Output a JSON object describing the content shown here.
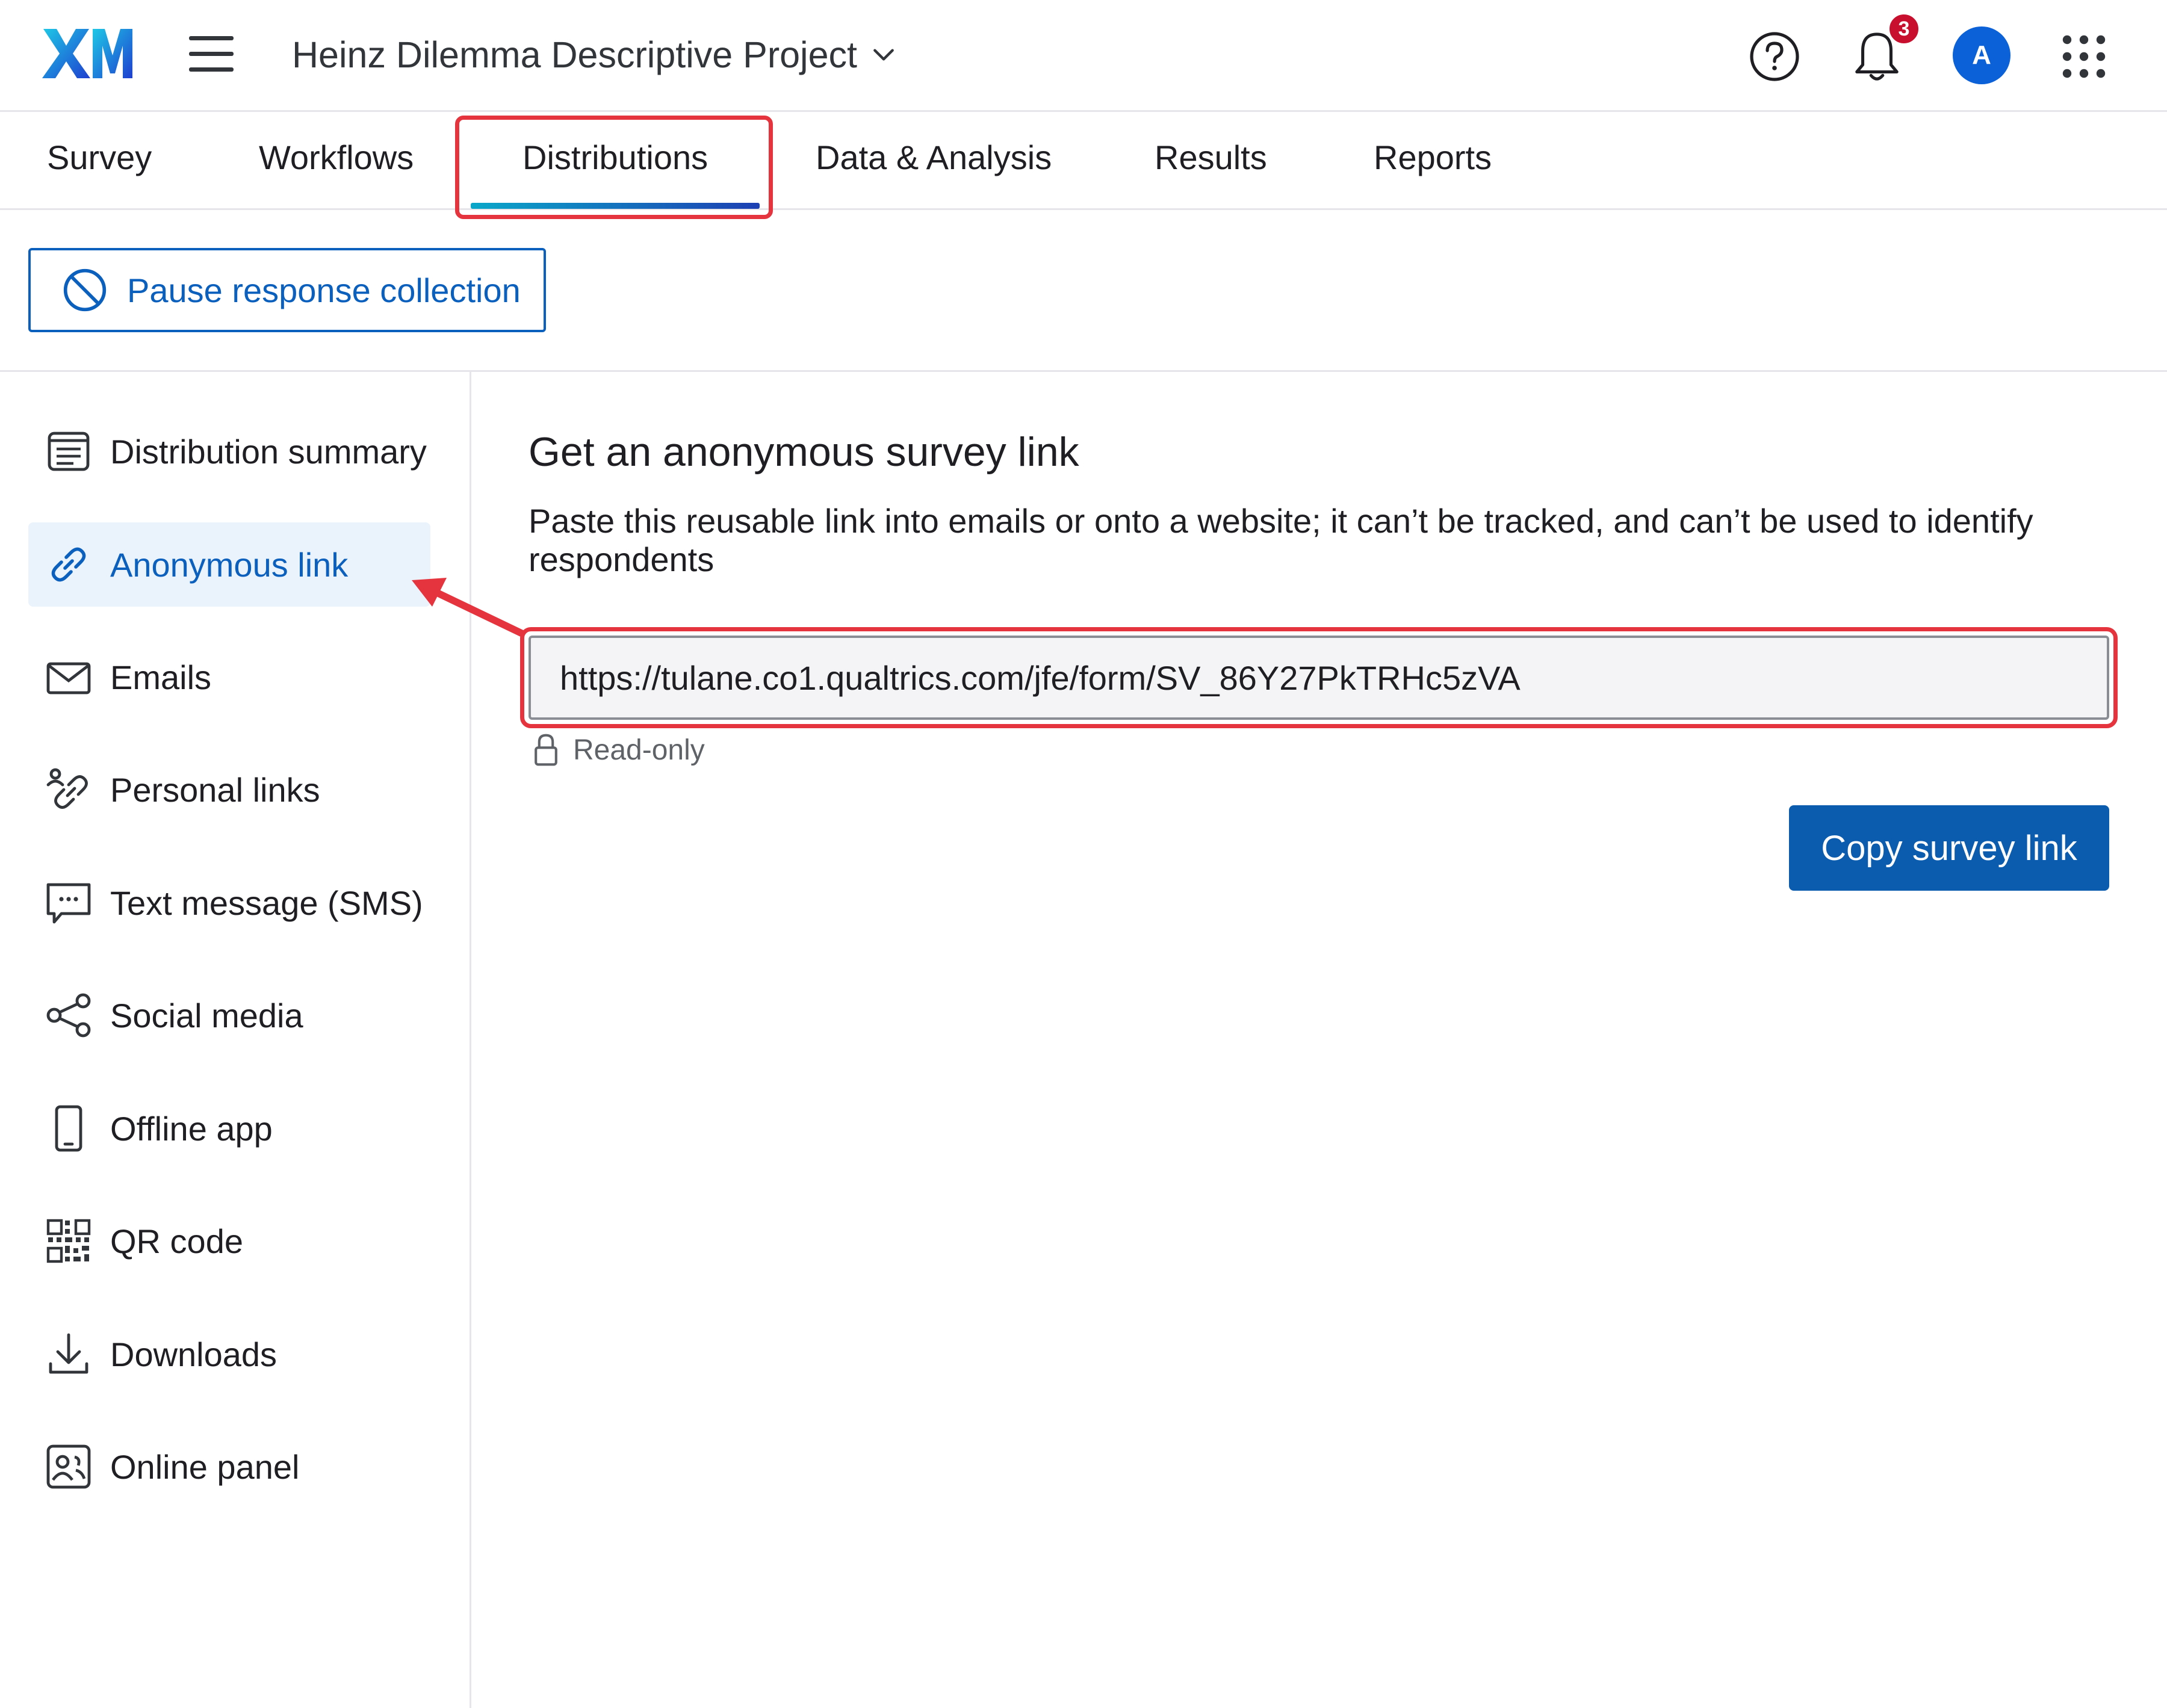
{
  "header": {
    "logo_text": "XM",
    "project_title": "Heinz Dilemma Descriptive Project",
    "notification_count": "3",
    "avatar_initial": "A",
    "icons": [
      "menu-icon",
      "chevron-down-icon",
      "help-icon",
      "bell-icon",
      "apps-grid-icon"
    ]
  },
  "tabs": [
    {
      "label": "Survey"
    },
    {
      "label": "Workflows"
    },
    {
      "label": "Distributions",
      "active": true
    },
    {
      "label": "Data & Analysis"
    },
    {
      "label": "Results"
    },
    {
      "label": "Reports"
    }
  ],
  "pause_button": {
    "label": "Pause response collection",
    "icon": "block-icon"
  },
  "sidebar": {
    "items": [
      {
        "label": "Distribution summary",
        "icon": "summary-list-icon"
      },
      {
        "label": "Anonymous link",
        "icon": "link-icon",
        "active": true
      },
      {
        "label": "Emails",
        "icon": "envelope-icon"
      },
      {
        "label": "Personal links",
        "icon": "personal-link-icon"
      },
      {
        "label": "Text message (SMS)",
        "icon": "sms-icon"
      },
      {
        "label": "Social media",
        "icon": "share-icon"
      },
      {
        "label": "Offline app",
        "icon": "phone-icon"
      },
      {
        "label": "QR code",
        "icon": "qr-code-icon"
      },
      {
        "label": "Downloads",
        "icon": "download-icon"
      },
      {
        "label": "Online panel",
        "icon": "panel-icon"
      }
    ]
  },
  "main": {
    "title": "Get an anonymous survey link",
    "description": "Paste this reusable link into emails or onto a website; it can’t be tracked, and can’t be used to identify respondents",
    "survey_link": "https://tulane.co1.qualtrics.com/jfe/form/SV_86Y27PkTRHc5zVA",
    "readonly_label": "Read-only",
    "copy_button": "Copy survey link"
  },
  "colors": {
    "accent_blue": "#0b5fbd",
    "button_blue": "#0b5cae",
    "highlight_red": "#e5343d",
    "active_bg": "#eaf3fc"
  }
}
